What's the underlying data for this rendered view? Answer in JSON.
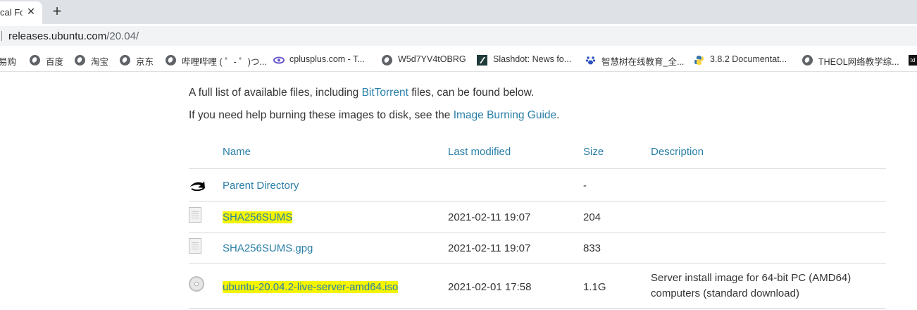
{
  "browser": {
    "tab": {
      "title": "cal Fo",
      "close_glyph": "✕"
    },
    "new_tab_glyph": "+",
    "address": {
      "host": "releases.ubuntu.com",
      "path": "/20.04/"
    },
    "bookmarks": [
      {
        "label": "易购",
        "icon": "none"
      },
      {
        "label": "百度",
        "icon": "globe-icon"
      },
      {
        "label": "淘宝",
        "icon": "globe-icon"
      },
      {
        "label": "京东",
        "icon": "globe-icon"
      },
      {
        "label": "哔哩哔哩 ( ゜- ゜)つ...",
        "icon": "globe-icon"
      },
      {
        "label": "cplusplus.com - T...",
        "icon": "cplusplus-icon"
      },
      {
        "label": "W5d7YV4tOBRG",
        "icon": "globe-icon"
      },
      {
        "label": "Slashdot: News fo...",
        "icon": "slashdot-icon"
      },
      {
        "label": "智慧树在线教育_全...",
        "icon": "paw-icon"
      },
      {
        "label": "3.8.2 Documentat...",
        "icon": "python-icon"
      },
      {
        "label": "THEOL网络教学综...",
        "icon": "globe-icon"
      },
      {
        "label": "td",
        "icon": "td-icon"
      }
    ]
  },
  "page": {
    "intro1": {
      "before": "A full list of available files, including ",
      "link": "BitTorrent",
      "after": " files, can be found below."
    },
    "intro2": {
      "before": "If you need help burning these images to disk, see the ",
      "link": "Image Burning Guide",
      "after": "."
    },
    "table": {
      "headers": {
        "name": "Name",
        "modified": "Last modified",
        "size": "Size",
        "description": "Description"
      },
      "rows": [
        {
          "name": "Parent Directory",
          "modified": "",
          "size": "-",
          "description": "",
          "icon": "back-icon",
          "highlight": false
        },
        {
          "name": "SHA256SUMS",
          "modified": "2021-02-11 19:07",
          "size": "204",
          "description": "",
          "icon": "file-icon",
          "highlight": true
        },
        {
          "name": "SHA256SUMS.gpg",
          "modified": "2021-02-11 19:07",
          "size": "833",
          "description": "",
          "icon": "file-icon",
          "highlight": false
        },
        {
          "name": "ubuntu-20.04.2-live-server-amd64.iso",
          "modified": "2021-02-01 17:58",
          "size": "1.1G",
          "description": "Server install image for 64-bit PC (AMD64) computers (standard download)",
          "icon": "disc-icon",
          "highlight": true
        }
      ]
    }
  },
  "colors": {
    "link": "#2a7fa8",
    "highlight": "#f5f500",
    "tabstrip": "#dee1e6"
  }
}
